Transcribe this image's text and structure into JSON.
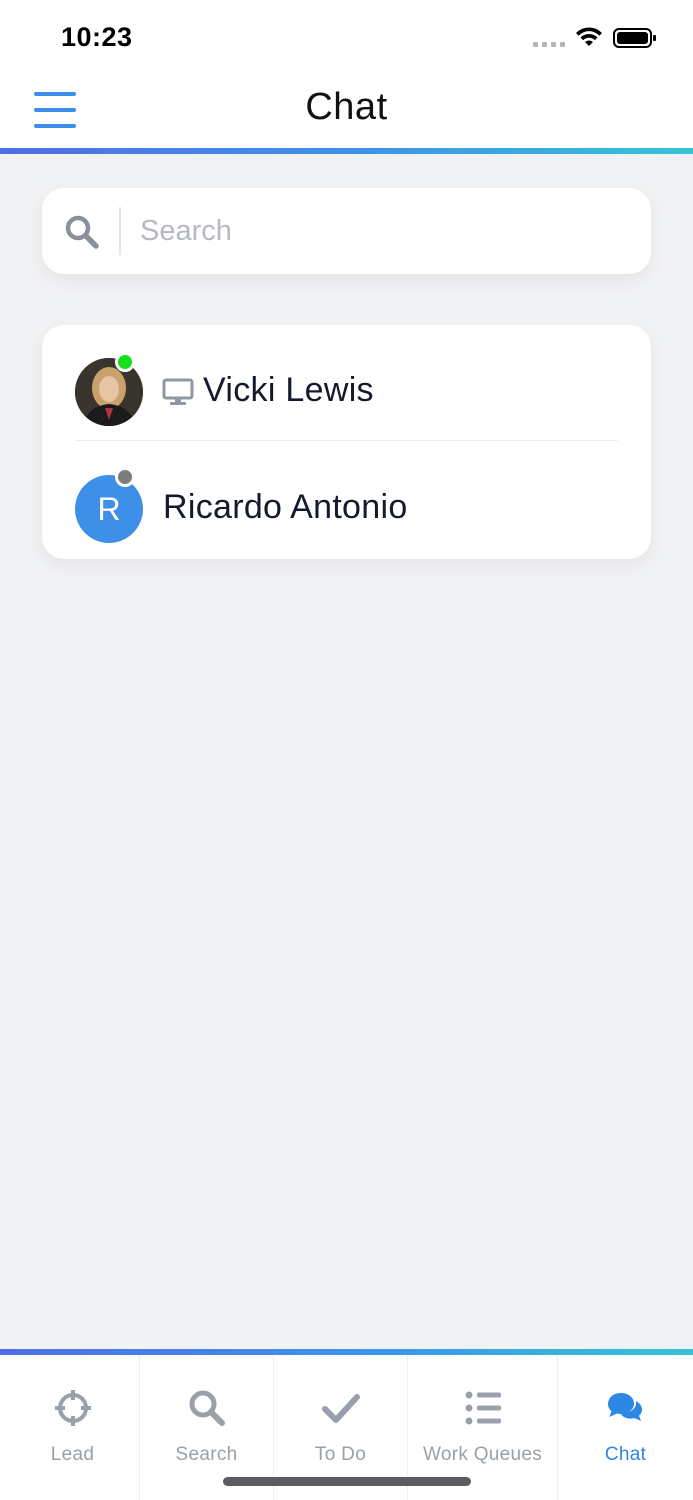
{
  "status_bar": {
    "time": "10:23"
  },
  "header": {
    "title": "Chat"
  },
  "search": {
    "placeholder": "Search"
  },
  "contacts": [
    {
      "name": "Vicki Lewis",
      "initial": "",
      "status": "online",
      "status_color": "#14e01c",
      "device_icon": "desktop-icon"
    },
    {
      "name": "Ricardo Antonio",
      "initial": "R",
      "status": "offline",
      "status_color": "#7d7d7d",
      "device_icon": ""
    }
  ],
  "tabs": [
    {
      "label": "Lead",
      "icon": "crosshair-icon",
      "active": false
    },
    {
      "label": "Search",
      "icon": "search-icon",
      "active": false
    },
    {
      "label": "To Do",
      "icon": "checkmark-icon",
      "active": false
    },
    {
      "label": "Work Queues",
      "icon": "list-icon",
      "active": false
    },
    {
      "label": "Chat",
      "icon": "chat-bubbles-icon",
      "active": true
    }
  ],
  "colors": {
    "accent": "#3b8fe8",
    "active_tab": "#2e87e4",
    "inactive_tab": "#9aa0a9",
    "background": "#f1f2f4"
  }
}
